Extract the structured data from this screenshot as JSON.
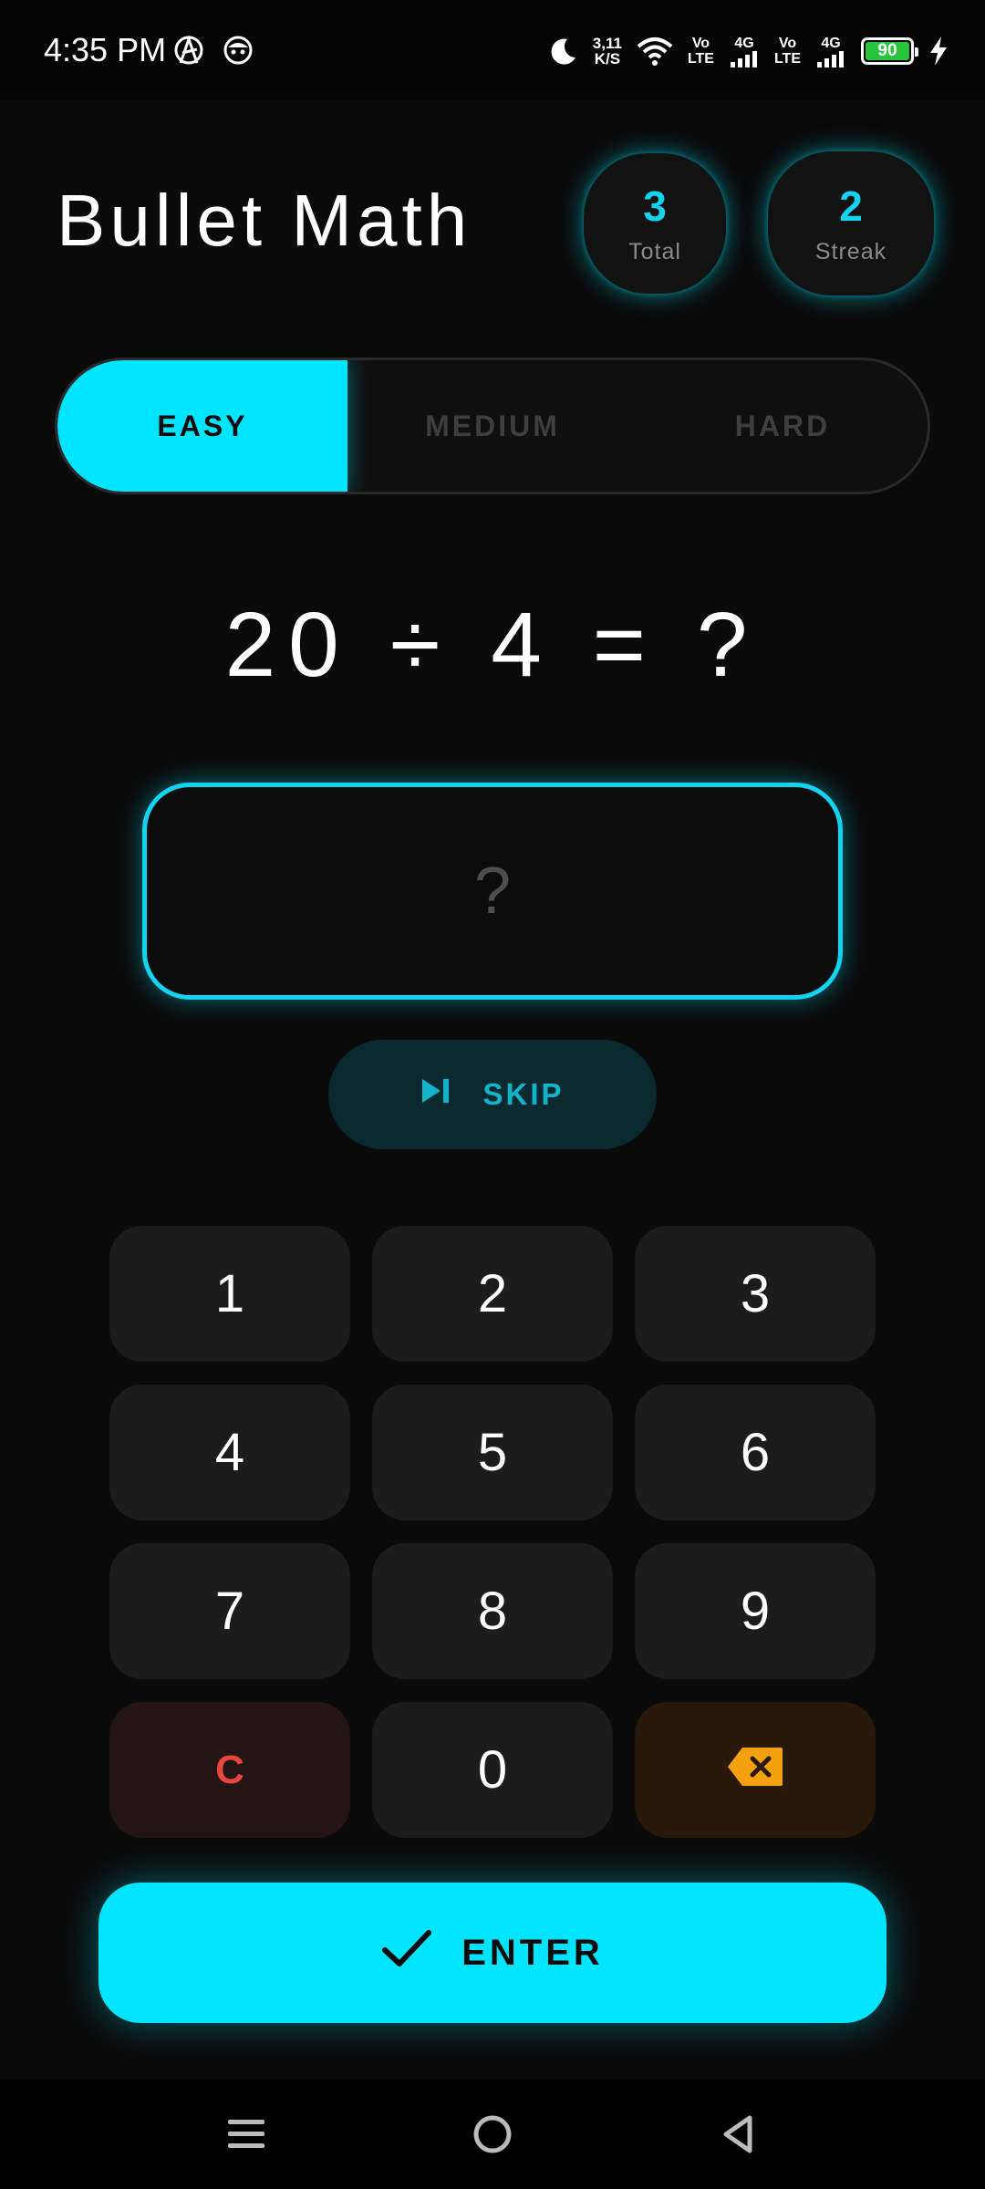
{
  "status_bar": {
    "time": "4:35 PM",
    "left_icons": [
      "anarchy-icon",
      "face-icon"
    ],
    "net_speed_value": "3,11",
    "net_speed_unit": "K/S",
    "sim1_tag_top": "Vo",
    "sim1_tag_bottom": "LTE",
    "sim1_network": "4G",
    "sim2_tag_top": "Vo",
    "sim2_tag_bottom": "LTE",
    "sim2_network": "4G",
    "battery_level": "90",
    "battery_color": "#27c43c"
  },
  "header": {
    "title": "Bullet Math",
    "stats": {
      "total_value": "3",
      "total_label": "Total",
      "streak_value": "2",
      "streak_label": "Streak"
    }
  },
  "difficulty": {
    "selected": "EASY",
    "options": [
      "EASY",
      "MEDIUM",
      "HARD"
    ]
  },
  "question": {
    "text": "20 ÷ 4 = ?"
  },
  "answer": {
    "placeholder": "?",
    "value": ""
  },
  "skip": {
    "label": "SKIP",
    "icon": "skip-next-icon"
  },
  "keypad": {
    "keys": [
      "1",
      "2",
      "3",
      "4",
      "5",
      "6",
      "7",
      "8",
      "9",
      "C",
      "0"
    ],
    "backspace_icon": "backspace-icon"
  },
  "enter": {
    "label": "ENTER",
    "icon": "check-icon"
  },
  "nav_bar": {
    "buttons": [
      "menu-icon",
      "home-icon",
      "back-icon"
    ]
  },
  "colors": {
    "accent": "#00e5ff",
    "background": "#0a0a0a",
    "key": "#1c1c1c",
    "clear_text": "#e8453c",
    "backspace": "#f5a00f"
  }
}
